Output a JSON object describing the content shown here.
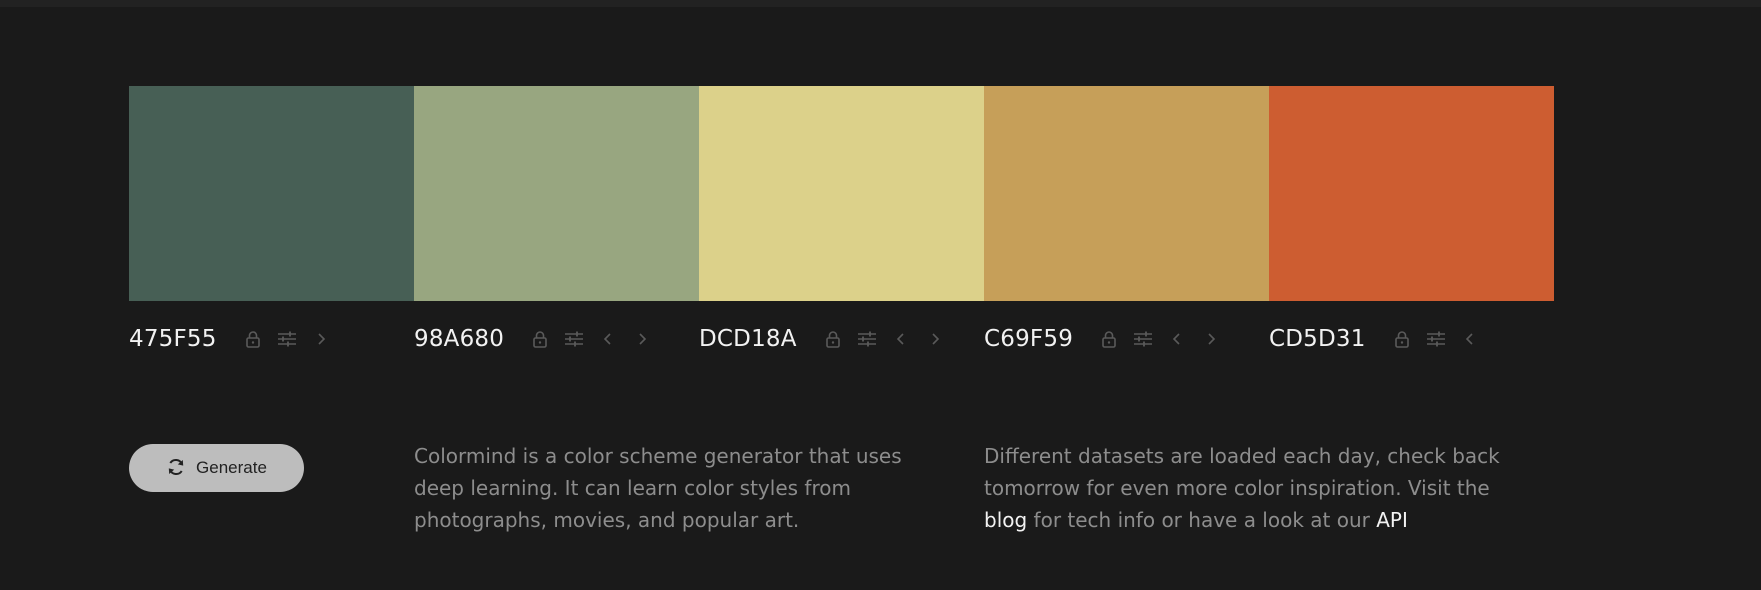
{
  "palette": {
    "colors": [
      {
        "hex": "475F55",
        "color": "#475F55",
        "has_left": false,
        "has_right": true
      },
      {
        "hex": "98A680",
        "color": "#98A680",
        "has_left": true,
        "has_right": true
      },
      {
        "hex": "DCD18A",
        "color": "#DCD18A",
        "has_left": true,
        "has_right": true
      },
      {
        "hex": "C69F59",
        "color": "#C69F59",
        "has_left": true,
        "has_right": true
      },
      {
        "hex": "CD5D31",
        "color": "#CD5D31",
        "has_left": true,
        "has_right": false
      }
    ],
    "icons": {
      "lock": "lock-icon",
      "adjust": "sliders-icon",
      "left": "chevron-left-icon",
      "right": "chevron-right-icon"
    }
  },
  "generate": {
    "label": "Generate",
    "icon": "refresh-icon"
  },
  "description": {
    "intro": "Colormind is a color scheme generator that uses deep learning. It can learn color styles from photographs, movies, and popular art.",
    "datasets_pre": "Different datasets are loaded each day, check back tomorrow for even more color inspiration. Visit the ",
    "blog_link": "blog",
    "datasets_mid": " for tech info or have a look at our ",
    "api_link": "API"
  },
  "theme": {
    "background": "#1a1a1a",
    "text": "#8d8d8d",
    "highlight": "#f2f2f2",
    "icon": "#5a5a5a",
    "button": "#bdbdbd"
  }
}
